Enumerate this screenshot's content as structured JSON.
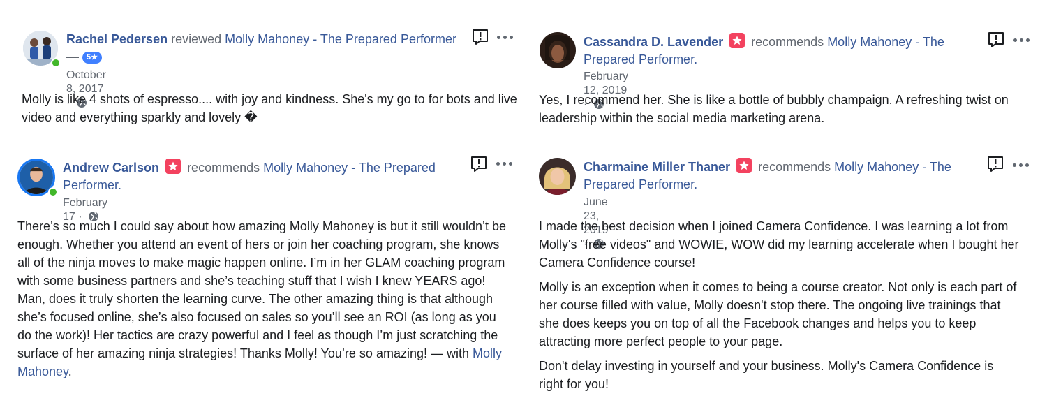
{
  "reviews": [
    {
      "author": "Rachel Pedersen",
      "verb": "reviewed",
      "page": "Molly Mahoney - The Prepared Performer",
      "dash": "—",
      "rating": "5★",
      "date": "October 8, 2017 ·",
      "paragraphs": [
        "Molly is like 4 shots of espresso.... with joy and kindness. She's my go to for bots and live video and everything sparkly and lovely �"
      ]
    },
    {
      "author": "Cassandra D. Lavender",
      "verb": "recommends",
      "page": "Molly Mahoney - The Prepared Performer.",
      "date": "February 12, 2019 ·",
      "paragraphs": [
        "Yes, I recommend her. She is like a bottle of bubbly champaign. A refreshing twist on leadership within the social media marketing arena."
      ]
    },
    {
      "author": "Andrew Carlson",
      "verb": "recommends",
      "page": "Molly Mahoney - The Prepared Performer.",
      "date": "February 17 ·",
      "paragraphs": [
        "There’s so much I could say about how amazing Molly Mahoney is but it still wouldn’t be enough. Whether you attend an event of hers or join her coaching program, she knows all of the ninja moves to make magic happen online. I’m in her GLAM coaching program with some business partners and she’s teaching stuff that I wish I knew YEARS ago! Man, does it truly shorten the learning curve. The other amazing thing is that although she’s focused online, she’s also focused on sales so you’ll see an ROI (as long as you do the work)! Her tactics are crazy powerful and I feel as though I’m just scratching the surface of her amazing ninja strategies! Thanks Molly! You’re so amazing! — with"
      ],
      "with_name": "Molly Mahoney",
      "with_end": "."
    },
    {
      "author": "Charmaine Miller Thaner",
      "verb": "recommends",
      "page": "Molly Mahoney - The Prepared Performer.",
      "date": "June 23, 2019 ·",
      "paragraphs": [
        "I made the best decision when I joined Camera Confidence. I was learning a lot from Molly's \"free videos\" and WOWIE, WOW did my learning accelerate when I bought her Camera Confidence course!",
        "Molly is an exception when it comes to being a course creator. Not only is each part of her course filled with value, Molly doesn't stop there. The ongoing live trainings that she does keeps you on top of all the Facebook changes and helps you to keep attracting more perfect people to your page.",
        "Don't delay investing in yourself and your business. Molly's Camera Confidence is right for you!"
      ]
    }
  ],
  "icons": {
    "report": "report-flag-icon",
    "more": "more-options-icon",
    "privacy": "globe-icon",
    "recommend": "recommendation-icon"
  },
  "colors": {
    "link": "#385898",
    "meta": "#616770",
    "recommend_badge": "#f3425f",
    "rating_badge": "#4080ff",
    "online": "#42b72a"
  }
}
